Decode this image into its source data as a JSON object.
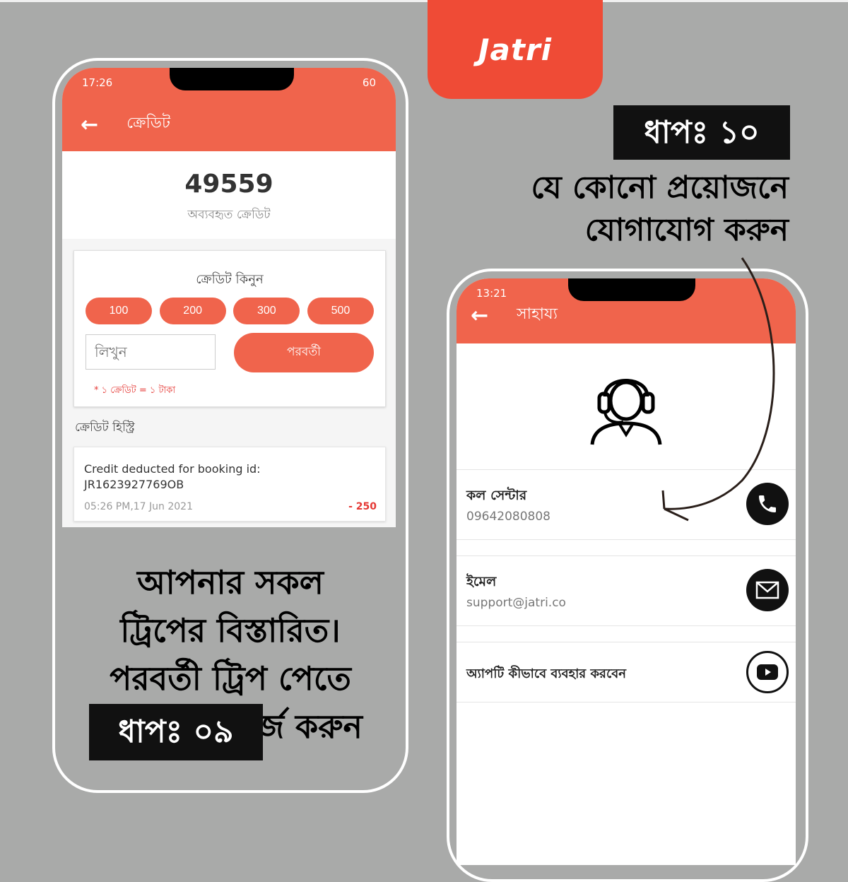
{
  "brand": {
    "logo_text": "Jatri",
    "accent_color": "#ef4b36"
  },
  "left_phone": {
    "status_time": "17:26",
    "status_right": "60",
    "appbar_title": "ক্রেডিট",
    "balance_value": "49559",
    "balance_label": "অব্যবহৃত ক্রেডিট",
    "buy_title": "ক্রেডিট কিনুন",
    "amount_options": [
      "100",
      "200",
      "300",
      "500"
    ],
    "input_placeholder": "লিখুন",
    "next_label": "পরবর্তী",
    "rate_note": "* ১ ক্রেডিট = ১ টাকা",
    "history_title": "ক্রেডিট হিস্ট্রি",
    "transactions": [
      {
        "description": "Credit deducted for booking id: JR1623927769OB",
        "date": "05:26 PM,17 Jun 2021",
        "amount": "- 250"
      }
    ]
  },
  "left_caption": [
    "আপনার সকল",
    "ট্রিপের বিস্তারিত।",
    "পরবর্তী ট্রিপ পেতে",
    "ক্রেডিট রিচার্জ করুন"
  ],
  "left_step": "ধাপঃ ০৯",
  "right_step": "ধাপঃ ১০",
  "right_caption": [
    "যে কোনো প্রয়োজনে",
    "যোগাযোগ করুন"
  ],
  "right_phone": {
    "status_time": "13:21",
    "appbar_title": "সাহায্য",
    "contacts": [
      {
        "label": "কল সেন্টার",
        "value": "09642080808",
        "icon": "phone-icon"
      },
      {
        "label": "ইমেল",
        "value": "support@jatri.co",
        "icon": "mail-icon"
      },
      {
        "label": "অ্যাপটি কীভাবে ব্যবহার করবেন",
        "value": "",
        "icon": "youtube-icon"
      }
    ]
  }
}
